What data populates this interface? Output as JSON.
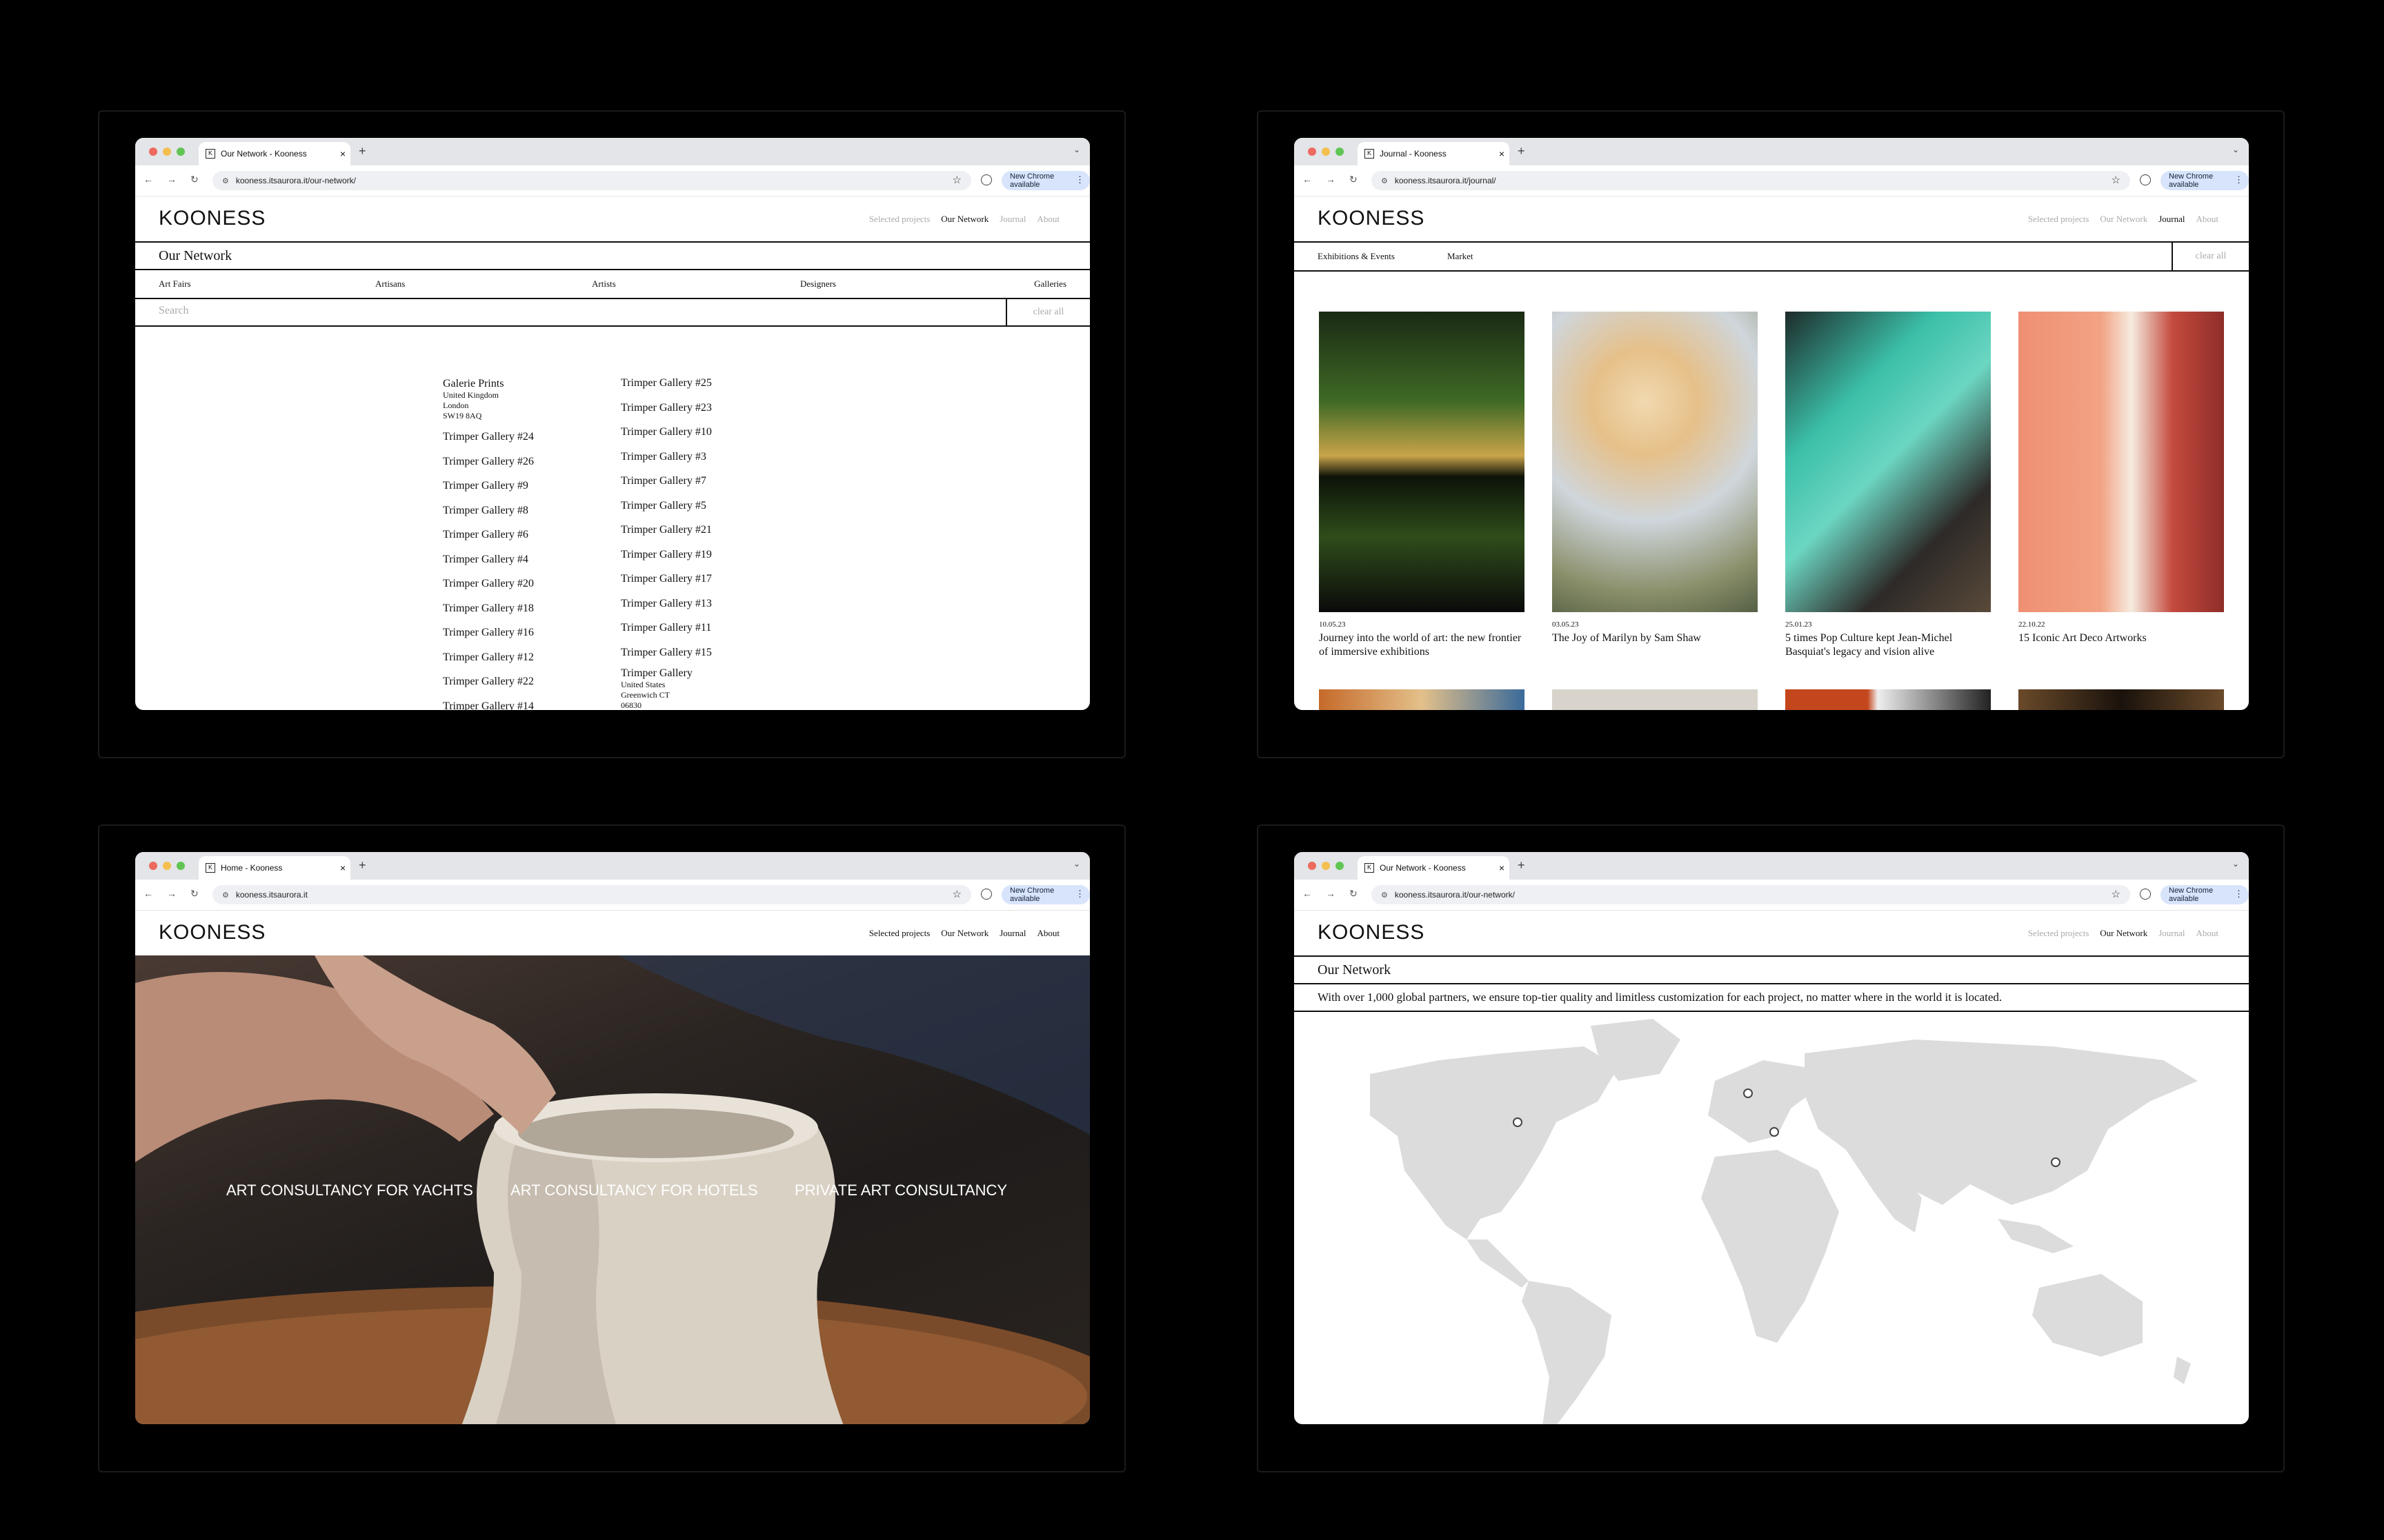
{
  "brand": "KOONESS",
  "menu": {
    "selected": "Selected projects",
    "network": "Our Network",
    "journal": "Journal",
    "about": "About"
  },
  "browser": {
    "new_chrome": "New Chrome available"
  },
  "network_list": {
    "tab_title": "Our Network - Kooness",
    "url": "kooness.itsaurora.it/our-network/",
    "title": "Our Network",
    "categories": [
      "Art Fairs",
      "Artisans",
      "Artists",
      "Designers",
      "Galleries"
    ],
    "search_placeholder": "Search",
    "clear_all": "clear all",
    "col1_first": {
      "name": "Galerie Prints",
      "line1": "United Kingdom",
      "line2": "London",
      "line3": "SW19 8AQ"
    },
    "col1": [
      "Trimper Gallery #24",
      "Trimper Gallery #26",
      "Trimper Gallery #9",
      "Trimper Gallery #8",
      "Trimper Gallery #6",
      "Trimper Gallery #4",
      "Trimper Gallery #20",
      "Trimper Gallery #18",
      "Trimper Gallery #16",
      "Trimper Gallery #12",
      "Trimper Gallery #22",
      "Trimper Gallery #14"
    ],
    "col2": [
      "Trimper Gallery #25",
      "Trimper Gallery #23",
      "Trimper Gallery #10",
      "Trimper Gallery #3",
      "Trimper Gallery #7",
      "Trimper Gallery #5",
      "Trimper Gallery #21",
      "Trimper Gallery #19",
      "Trimper Gallery #17",
      "Trimper Gallery #13",
      "Trimper Gallery #11",
      "Trimper Gallery #15"
    ],
    "col2_last": {
      "name": "Trimper Gallery",
      "line1": "United States",
      "line2": "Greenwich CT",
      "line3": "06830"
    }
  },
  "journal": {
    "tab_title": "Journal - Kooness",
    "url": "kooness.itsaurora.it/journal/",
    "filters": [
      "Exhibitions & Events",
      "Market"
    ],
    "clear_all": "clear all",
    "articles": [
      {
        "date": "10.05.23",
        "title": "Journey into the world of art: the new frontier of immersive exhibitions"
      },
      {
        "date": "03.05.23",
        "title": "The Joy of Marilyn by Sam Shaw"
      },
      {
        "date": "25.01.23",
        "title": "5 times Pop Culture kept Jean-Michel Basquiat's legacy and vision alive"
      },
      {
        "date": "22.10.22",
        "title": "15 Iconic Art Deco Artworks"
      }
    ]
  },
  "home": {
    "tab_title": "Home - Kooness",
    "url": "kooness.itsaurora.it",
    "hero_items": [
      "ART CONSULTANCY FOR YACHTS",
      "ART CONSULTANCY FOR HOTELS",
      "PRIVATE ART CONSULTANCY"
    ]
  },
  "network_map": {
    "tab_title": "Our Network - Kooness",
    "url": "kooness.itsaurora.it/our-network/",
    "title": "Our Network",
    "intro": "With over 1,000 global partners, we ensure top-tier quality and limitless customization for each project, no matter where in the world it is located."
  }
}
